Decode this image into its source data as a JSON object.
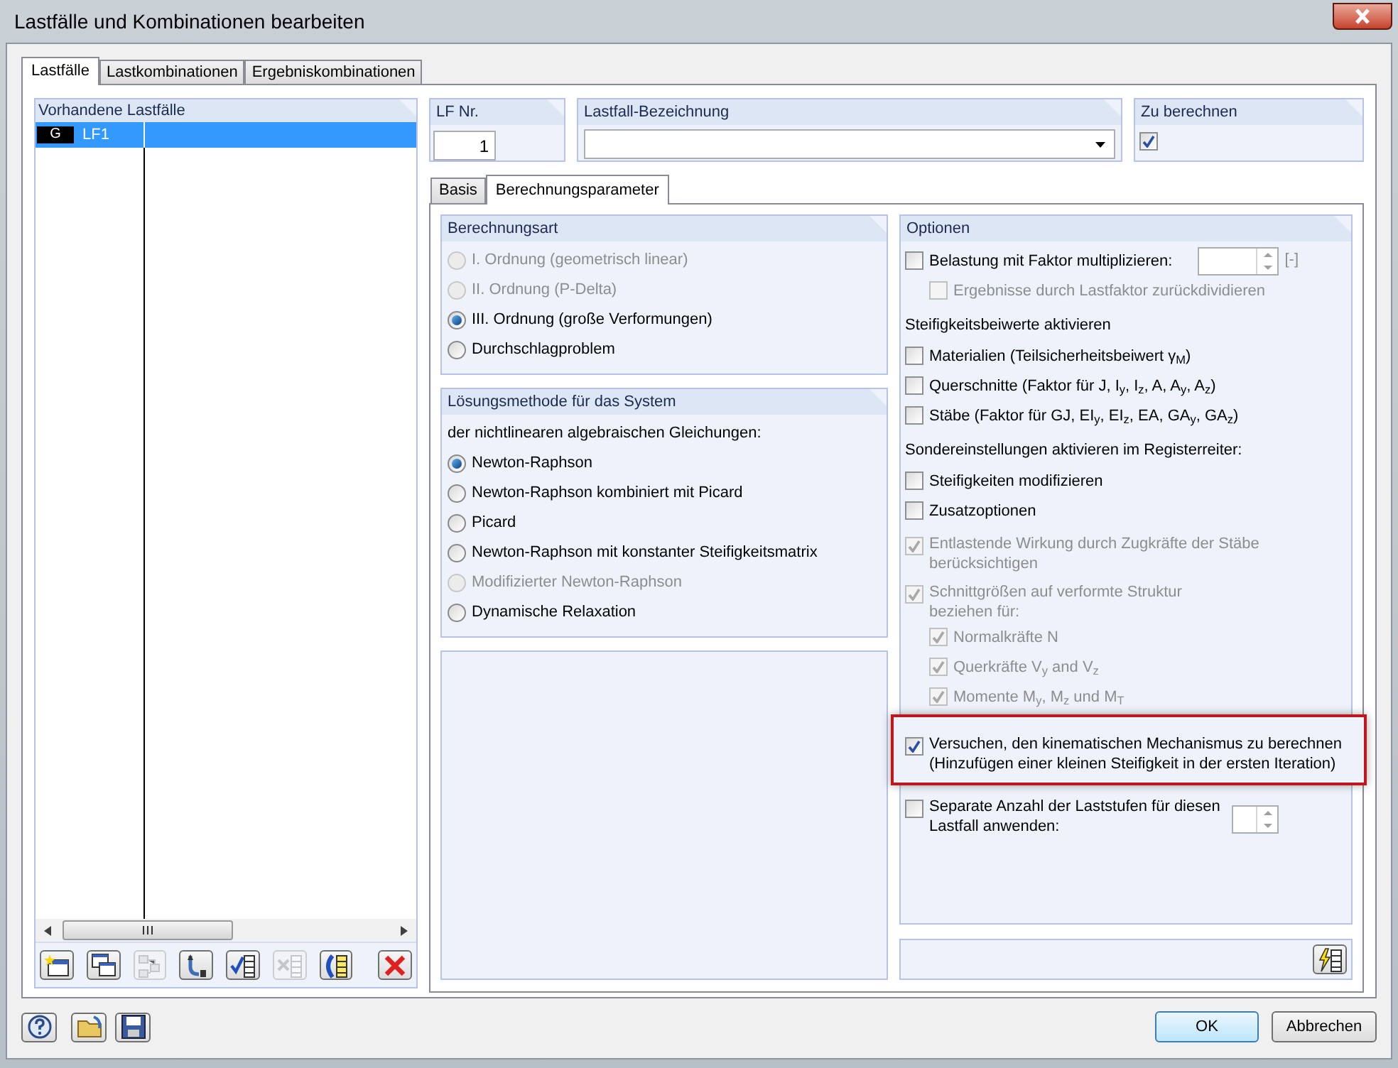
{
  "window": {
    "title": "Lastfälle und Kombinationen bearbeiten"
  },
  "tabs": [
    {
      "label": "Lastfälle",
      "selected": true
    },
    {
      "label": "Lastkombinationen",
      "selected": false
    },
    {
      "label": "Ergebniskombinationen",
      "selected": false
    }
  ],
  "load_cases": {
    "header": "Vorhandene Lastfälle",
    "rows": [
      {
        "type": "G",
        "name": "LF1",
        "selected": true
      }
    ]
  },
  "list_toolbar": [
    {
      "kind": "new",
      "disabled": false
    },
    {
      "kind": "copy",
      "disabled": false
    },
    {
      "kind": "arrange",
      "disabled": true
    },
    {
      "kind": "renumber",
      "disabled": false
    },
    {
      "kind": "check-all",
      "disabled": false
    },
    {
      "kind": "uncheck-all",
      "disabled": true
    },
    {
      "kind": "invert",
      "disabled": false
    },
    {
      "kind": "delete",
      "disabled": false
    }
  ],
  "lf_nr": {
    "label": "LF Nr.",
    "value": "1"
  },
  "designation": {
    "label": "Lastfall-Bezeichnung"
  },
  "to_calculate": {
    "label": "Zu berechnen",
    "checked": true
  },
  "subtabs": [
    {
      "label": "Basis",
      "selected": false
    },
    {
      "label": "Berechnungsparameter",
      "selected": true
    }
  ],
  "calc_type": {
    "title": "Berechnungsart",
    "options": [
      {
        "label": "I. Ordnung (geometrisch linear)",
        "selected": false,
        "disabled": true
      },
      {
        "label": "II. Ordnung (P-Delta)",
        "selected": false,
        "disabled": true
      },
      {
        "label": "III. Ordnung (große Verformungen)",
        "selected": true,
        "disabled": false
      },
      {
        "label": "Durchschlagproblem",
        "selected": false,
        "disabled": false
      }
    ]
  },
  "solution": {
    "title": "Lösungsmethode für das System",
    "intro": "der nichtlinearen algebraischen Gleichungen:",
    "options": [
      {
        "label": "Newton-Raphson",
        "selected": true,
        "disabled": false
      },
      {
        "label": "Newton-Raphson kombiniert mit Picard",
        "selected": false,
        "disabled": false
      },
      {
        "label": "Picard",
        "selected": false,
        "disabled": false
      },
      {
        "label": "Newton-Raphson mit konstanter Steifigkeitsmatrix",
        "selected": false,
        "disabled": false
      },
      {
        "label": "Modifizierter Newton-Raphson",
        "selected": false,
        "disabled": true
      },
      {
        "label": "Dynamische Relaxation",
        "selected": false,
        "disabled": false
      }
    ]
  },
  "options": {
    "title": "Optionen",
    "items": [
      {
        "kind": "checkbox",
        "label": "Belastung mit Faktor multiplizieren:",
        "checked": false,
        "disabled": false,
        "unit": "[-]",
        "children": [
          {
            "kind": "checkbox",
            "label": "Ergebnisse durch Lastfaktor zurückdividieren",
            "checked": false,
            "disabled": true
          }
        ]
      },
      {
        "kind": "heading",
        "label": "Steifigkeitsbeiwerte aktivieren"
      },
      {
        "kind": "checkbox",
        "label": "Materialien (Teilsicherheitsbeiwert γ$_{M}$)",
        "checked": false,
        "disabled": false
      },
      {
        "kind": "checkbox",
        "label": "Querschnitte (Faktor für J, I$_{y}$, I$_{z}$, A, A$_{y}$, A$_{z}$)",
        "checked": false,
        "disabled": false
      },
      {
        "kind": "checkbox",
        "label": "Stäbe (Faktor für GJ, EI$_{y}$, EI$_{z}$, EA, GA$_{y}$, GA$_{z}$)",
        "checked": false,
        "disabled": false
      },
      {
        "kind": "heading",
        "label": "Sondereinstellungen aktivieren im Registerreiter:"
      },
      {
        "kind": "checkbox",
        "label": "Steifigkeiten modifizieren",
        "checked": false,
        "disabled": false
      },
      {
        "kind": "checkbox",
        "label": "Zusatzoptionen",
        "checked": false,
        "disabled": false
      },
      {
        "kind": "checkbox",
        "lines": [
          "Entlastende Wirkung durch Zugkräfte der Stäbe",
          "berücksichtigen"
        ],
        "checked": true,
        "disabled": true
      },
      {
        "kind": "checkbox",
        "lines": [
          "Schnittgrößen auf verformte Struktur",
          "beziehen für:"
        ],
        "checked": true,
        "disabled": true,
        "children": [
          {
            "kind": "checkbox",
            "label": "Normalkräfte N",
            "checked": true,
            "disabled": true
          },
          {
            "kind": "checkbox",
            "label": "Querkräfte V$_{y}$ and V$_{z}$",
            "checked": true,
            "disabled": true
          },
          {
            "kind": "checkbox",
            "label": "Momente M$_{y}$, M$_{z}$ und M$_{T}$",
            "checked": true,
            "disabled": true
          }
        ]
      },
      {
        "kind": "checkbox",
        "lines": [
          "Versuchen, den kinematischen Mechanismus zu berechnen",
          "(Hinzufügen einer kleinen Steifigkeit in der ersten Iteration)"
        ],
        "checked": true,
        "disabled": false,
        "highlighted": true
      },
      {
        "kind": "checkbox",
        "lines": [
          "Separate Anzahl der Laststufen für diesen",
          "Lastfall anwenden:"
        ],
        "checked": false,
        "disabled": false,
        "spinner": true
      }
    ]
  },
  "buttons": [
    {
      "label": "OK",
      "default": true
    },
    {
      "label": "Abbrechen",
      "default": false
    }
  ]
}
